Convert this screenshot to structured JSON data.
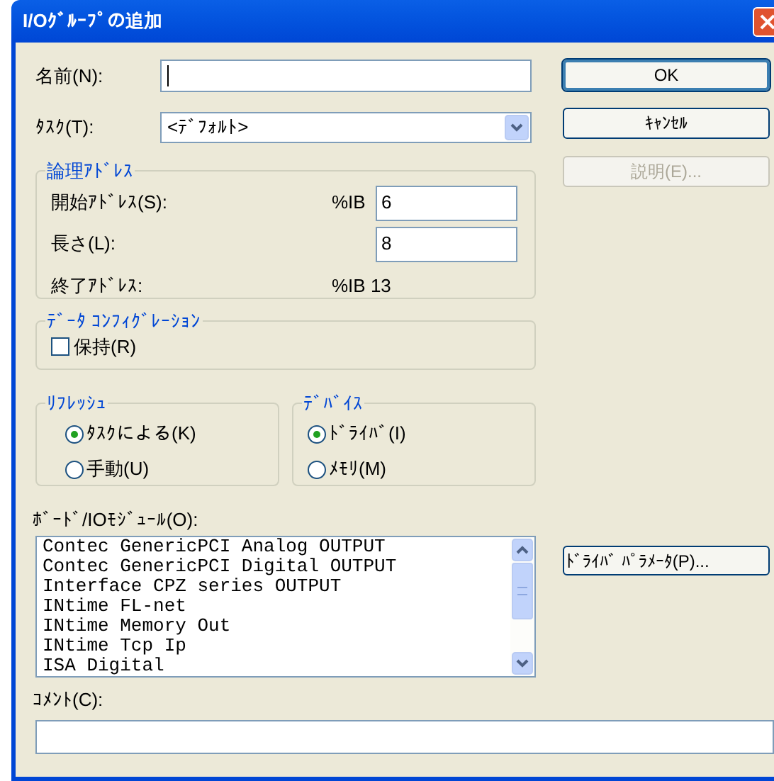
{
  "window": {
    "title": "I/Oｸﾞﾙｰﾌﾟの追加"
  },
  "name": {
    "label": "名前(N):"
  },
  "task": {
    "label": "ﾀｽｸ(T):",
    "value": "<ﾃﾞﾌｫﾙﾄ>"
  },
  "logical_address": {
    "title": "論理ｱﾄﾞﾚｽ",
    "start": {
      "label": "開始ｱﾄﾞﾚｽ(S):",
      "prefix": "%IB",
      "value": "6"
    },
    "length": {
      "label": "長さ(L):",
      "value": "8"
    },
    "end": {
      "label": "終了ｱﾄﾞﾚｽ:",
      "value": "%IB 13"
    }
  },
  "data_configuration": {
    "title": "ﾃﾞｰﾀ ｺﾝﾌｨｸﾞﾚｰｼｮﾝ",
    "checkboxes": [
      {
        "label": "保持(R)",
        "checked": false
      }
    ]
  },
  "refresh": {
    "title": "ﾘﾌﾚｯｼｭ",
    "options": [
      {
        "label": "ﾀｽｸによる(K)",
        "selected": true
      },
      {
        "label": "手動(U)",
        "selected": false
      }
    ]
  },
  "device": {
    "title": "ﾃﾞﾊﾞｲｽ",
    "options": [
      {
        "label": "ﾄﾞﾗｲﾊﾞ(I)",
        "selected": true
      },
      {
        "label": "ﾒﾓﾘ(M)",
        "selected": false
      }
    ]
  },
  "modules": {
    "label": "ﾎﾞｰﾄﾞ/IOﾓｼﾞｭｰﾙ(O):",
    "items": [
      "Contec GenericPCI Analog OUTPUT",
      "Contec GenericPCI Digital OUTPUT",
      "Interface CPZ series OUTPUT",
      "INtime FL-net",
      "INtime Memory Out",
      "INtime Tcp Ip",
      "ISA Digital"
    ]
  },
  "comment": {
    "label": "ｺﾒﾝﾄ(C):"
  },
  "buttons": [
    {
      "label": "OK",
      "default": true,
      "disabled": false
    },
    {
      "label": "ｷｬﾝｾﾙ",
      "default": false,
      "disabled": false
    },
    {
      "label": "説明(E)...",
      "default": false,
      "disabled": true
    }
  ],
  "driver_parameters_button": {
    "label": "ﾄﾞﾗｲﾊﾞ ﾊﾟﾗﾒｰﾀ(P)..."
  }
}
